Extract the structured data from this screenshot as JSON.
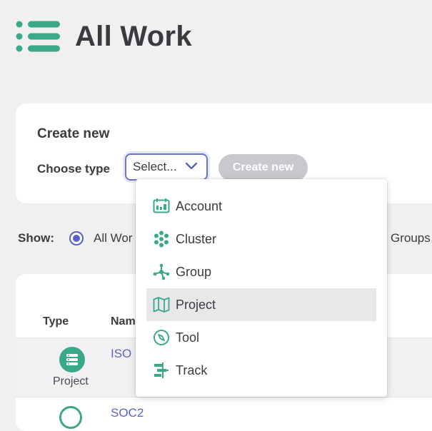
{
  "header": {
    "title": "All Work",
    "icon": "list-icon"
  },
  "create_card": {
    "title": "Create new",
    "choose_label": "Choose type",
    "select_value": "Select...",
    "create_button": "Create new"
  },
  "show": {
    "label": "Show:",
    "option_selected": "All Wor",
    "option_other": "Groups"
  },
  "table": {
    "columns": [
      "Type",
      "Nam"
    ],
    "rows": [
      {
        "type": "Project",
        "name": "ISO"
      },
      {
        "type": "",
        "name": "SOC2"
      }
    ]
  },
  "dropdown": {
    "options": [
      {
        "label": "Account",
        "icon": "account-icon"
      },
      {
        "label": "Cluster",
        "icon": "cluster-icon"
      },
      {
        "label": "Group",
        "icon": "group-icon"
      },
      {
        "label": "Project",
        "icon": "map-icon",
        "highlighted": true
      },
      {
        "label": "Tool",
        "icon": "compass-icon"
      },
      {
        "label": "Track",
        "icon": "track-icon"
      }
    ]
  },
  "colors": {
    "accent_green": "#3aa98a",
    "accent_indigo": "#5b63c7",
    "disabled_button": "#c8c8ce",
    "background": "#f0f0f1"
  }
}
